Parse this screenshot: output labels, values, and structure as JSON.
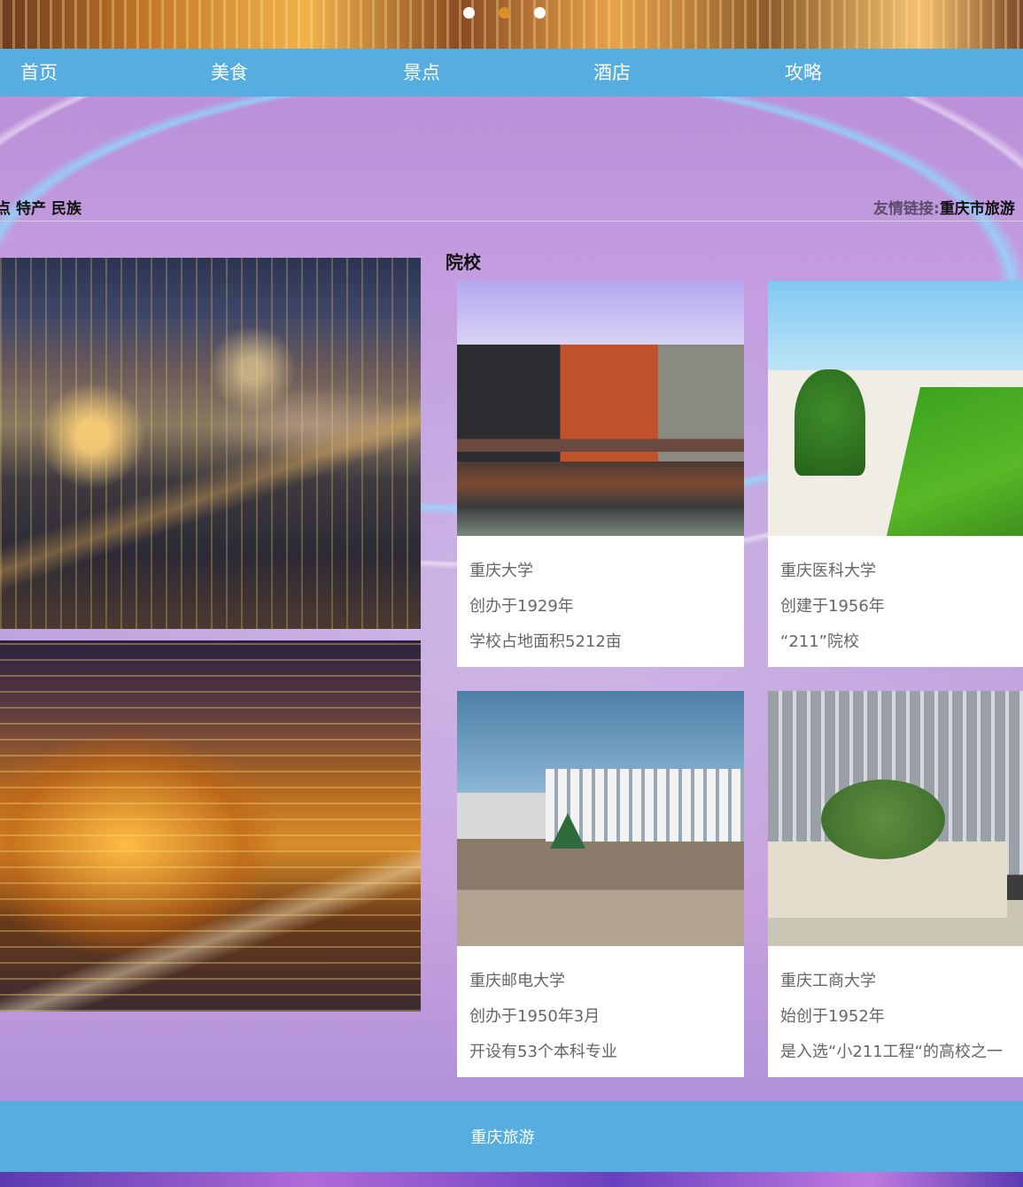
{
  "carousel": {
    "dots": [
      "dot-1",
      "dot-2",
      "dot-3"
    ],
    "active_index": 1
  },
  "nav": {
    "items": [
      {
        "label": "首页"
      },
      {
        "label": "美食"
      },
      {
        "label": "景点"
      },
      {
        "label": "酒店"
      },
      {
        "label": "攻略"
      }
    ]
  },
  "subbar": {
    "left_links": [
      "景点",
      "特产",
      "民族"
    ],
    "friend_label": "友情链接:",
    "friend_link": "重庆市旅游"
  },
  "section": {
    "title": "院校"
  },
  "cards": [
    {
      "name": "重庆大学",
      "line1": "创办于1929年",
      "line2": "学校占地面积5212亩"
    },
    {
      "name": "重庆医科大学",
      "line1": "创建于1956年",
      "line2": "“211”院校"
    },
    {
      "name": "重庆邮电大学",
      "line1": "创办于1950年3月",
      "line2": "开设有53个本科专业"
    },
    {
      "name": "重庆工商大学",
      "line1": "始创于1952年",
      "line2": "是入选“小211工程“的高校之一"
    }
  ],
  "footer": {
    "text": "重庆旅游"
  },
  "colors": {
    "nav_bg": "#55ade0",
    "footer_bg": "#55ade0",
    "active_dot": "#d98f2a"
  }
}
